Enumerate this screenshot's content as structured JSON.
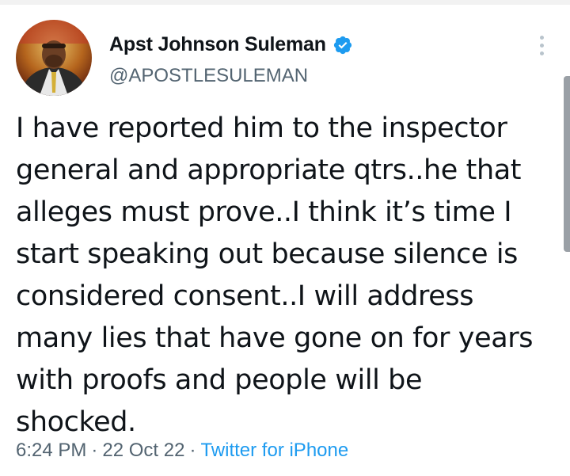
{
  "tweet": {
    "author": {
      "display_name": "Apst Johnson Suleman",
      "handle": "@APOSTLESULEMAN",
      "verified": true,
      "verified_badge_color": "#1d9bf0"
    },
    "text_lines": [
      "I have reported him to the inspector",
      "general and appropriate qtrs..he that",
      "alleges must prove..I think it’s time I",
      "start speaking out because silence is",
      "considered consent..I will address",
      "many lies that have gone on for years",
      "with proofs and people will be",
      "shocked."
    ],
    "meta": {
      "time": "6:24 PM",
      "separator": "·",
      "date": "22 Oct 22",
      "source": "Twitter for iPhone"
    }
  },
  "icons": {
    "verified": "verified-badge-icon",
    "more": "more-vertical-icon"
  },
  "colors": {
    "text_primary": "#0f1419",
    "text_secondary": "#536471",
    "link": "#1d9bf0"
  }
}
